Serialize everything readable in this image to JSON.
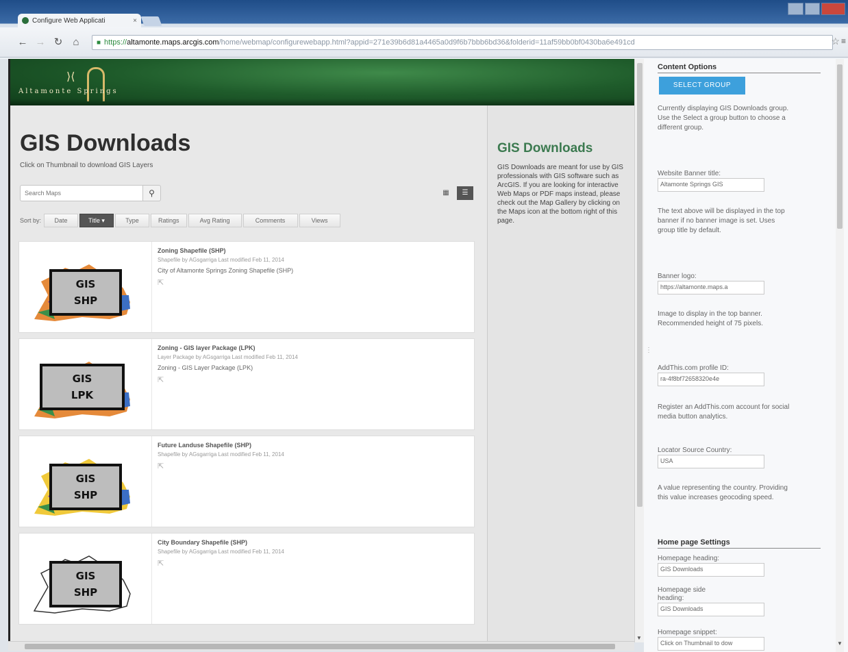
{
  "browser": {
    "tab_title": "Configure Web Applicati",
    "tab_close": "×",
    "url_scheme": "https://",
    "url_host": "altamonte.maps.arcgis.com",
    "url_path": "/home/webmap/configurewebapp.html?appid=271e39b6d81a4465a0d9f6b7bbb6bd36&folderid=11af59bb0bf0430ba6e491cd"
  },
  "banner": {
    "logo_text": "Altamonte Springs"
  },
  "main": {
    "title": "GIS Downloads",
    "subtitle": "Click on Thumbnail to download GIS Layers",
    "search_placeholder": "Search Maps",
    "sort_label": "Sort by:",
    "sort_buttons": [
      "Date",
      "Title ▾",
      "Type",
      "Ratings",
      "Avg Rating",
      "Comments",
      "Views"
    ],
    "active_sort": "Title ▾"
  },
  "items": [
    {
      "title": "Zoning Shapefile (SHP)",
      "meta": "Shapefile by AGsgarriga  Last modified Feb 11, 2014",
      "desc": "City of Altamonte Springs Zoning Shapefile (SHP)",
      "badge_line1": "GIS",
      "badge_line2": "SHP"
    },
    {
      "title": "Zoning - GIS layer Package (LPK)",
      "meta": "Layer Package by AGsgarriga  Last modified Feb 11, 2014",
      "desc": "Zoning - GIS Layer Package (LPK)",
      "badge_line1": "GIS",
      "badge_line2": "LPK"
    },
    {
      "title": "Future Landuse Shapefile (SHP)",
      "meta": "Shapefile by AGsgarriga  Last modified Feb 11, 2014",
      "desc": "",
      "badge_line1": "GIS",
      "badge_line2": "SHP"
    },
    {
      "title": "City Boundary Shapefile (SHP)",
      "meta": "Shapefile by AGsgarriga  Last modified Feb 11, 2014",
      "desc": "",
      "badge_line1": "GIS",
      "badge_line2": "SHP"
    }
  ],
  "side": {
    "title": "GIS Downloads",
    "text": "GIS Downloads are meant for use by GIS professionals with GIS software such as ArcGIS. If you are looking for interactive Web Maps or PDF maps instead, please check out the Map Gallery by clicking on the Maps icon at the bottom right of this page."
  },
  "config": {
    "content_options_heading": "Content Options",
    "select_group_label": "SELECT GROUP",
    "group_note": "Currently displaying GIS Downloads group. Use the Select a group button to choose a different group.",
    "banner_title_label": "Website Banner title:",
    "banner_title_value": "Altamonte Springs GIS",
    "banner_title_note": "The text above will be displayed in the top banner if no banner image is set. Uses group title by default.",
    "banner_logo_label": "Banner logo:",
    "banner_logo_value": "https://altamonte.maps.a",
    "banner_logo_note": "Image to display in the top banner. Recommended height of 75 pixels.",
    "addthis_label": "AddThis.com profile ID:",
    "addthis_value": "ra-4f8bf72658320e4e",
    "addthis_note": "Register an AddThis.com account for social media button analytics.",
    "locator_label": "Locator Source Country:",
    "locator_value": "USA",
    "locator_note": "A value representing the country. Providing this value increases geocoding speed.",
    "home_heading": "Home page Settings",
    "home_heading_label": "Homepage heading:",
    "home_heading_value": "GIS Downloads",
    "side_heading_label": "Homepage side heading:",
    "side_heading_value": "GIS Downloads",
    "snippet_label": "Homepage snippet:",
    "snippet_value": "Click on Thumbnail to dow"
  },
  "colors": {
    "banner_green": "#1f5c2b",
    "side_title_green": "#3c7a50",
    "select_button_blue": "#3da0dc"
  },
  "icons": {
    "search": "search-icon",
    "grid_view": "grid-view-icon",
    "list_view": "list-view-icon",
    "share": "share-icon",
    "bookmark_star": "star-icon"
  }
}
